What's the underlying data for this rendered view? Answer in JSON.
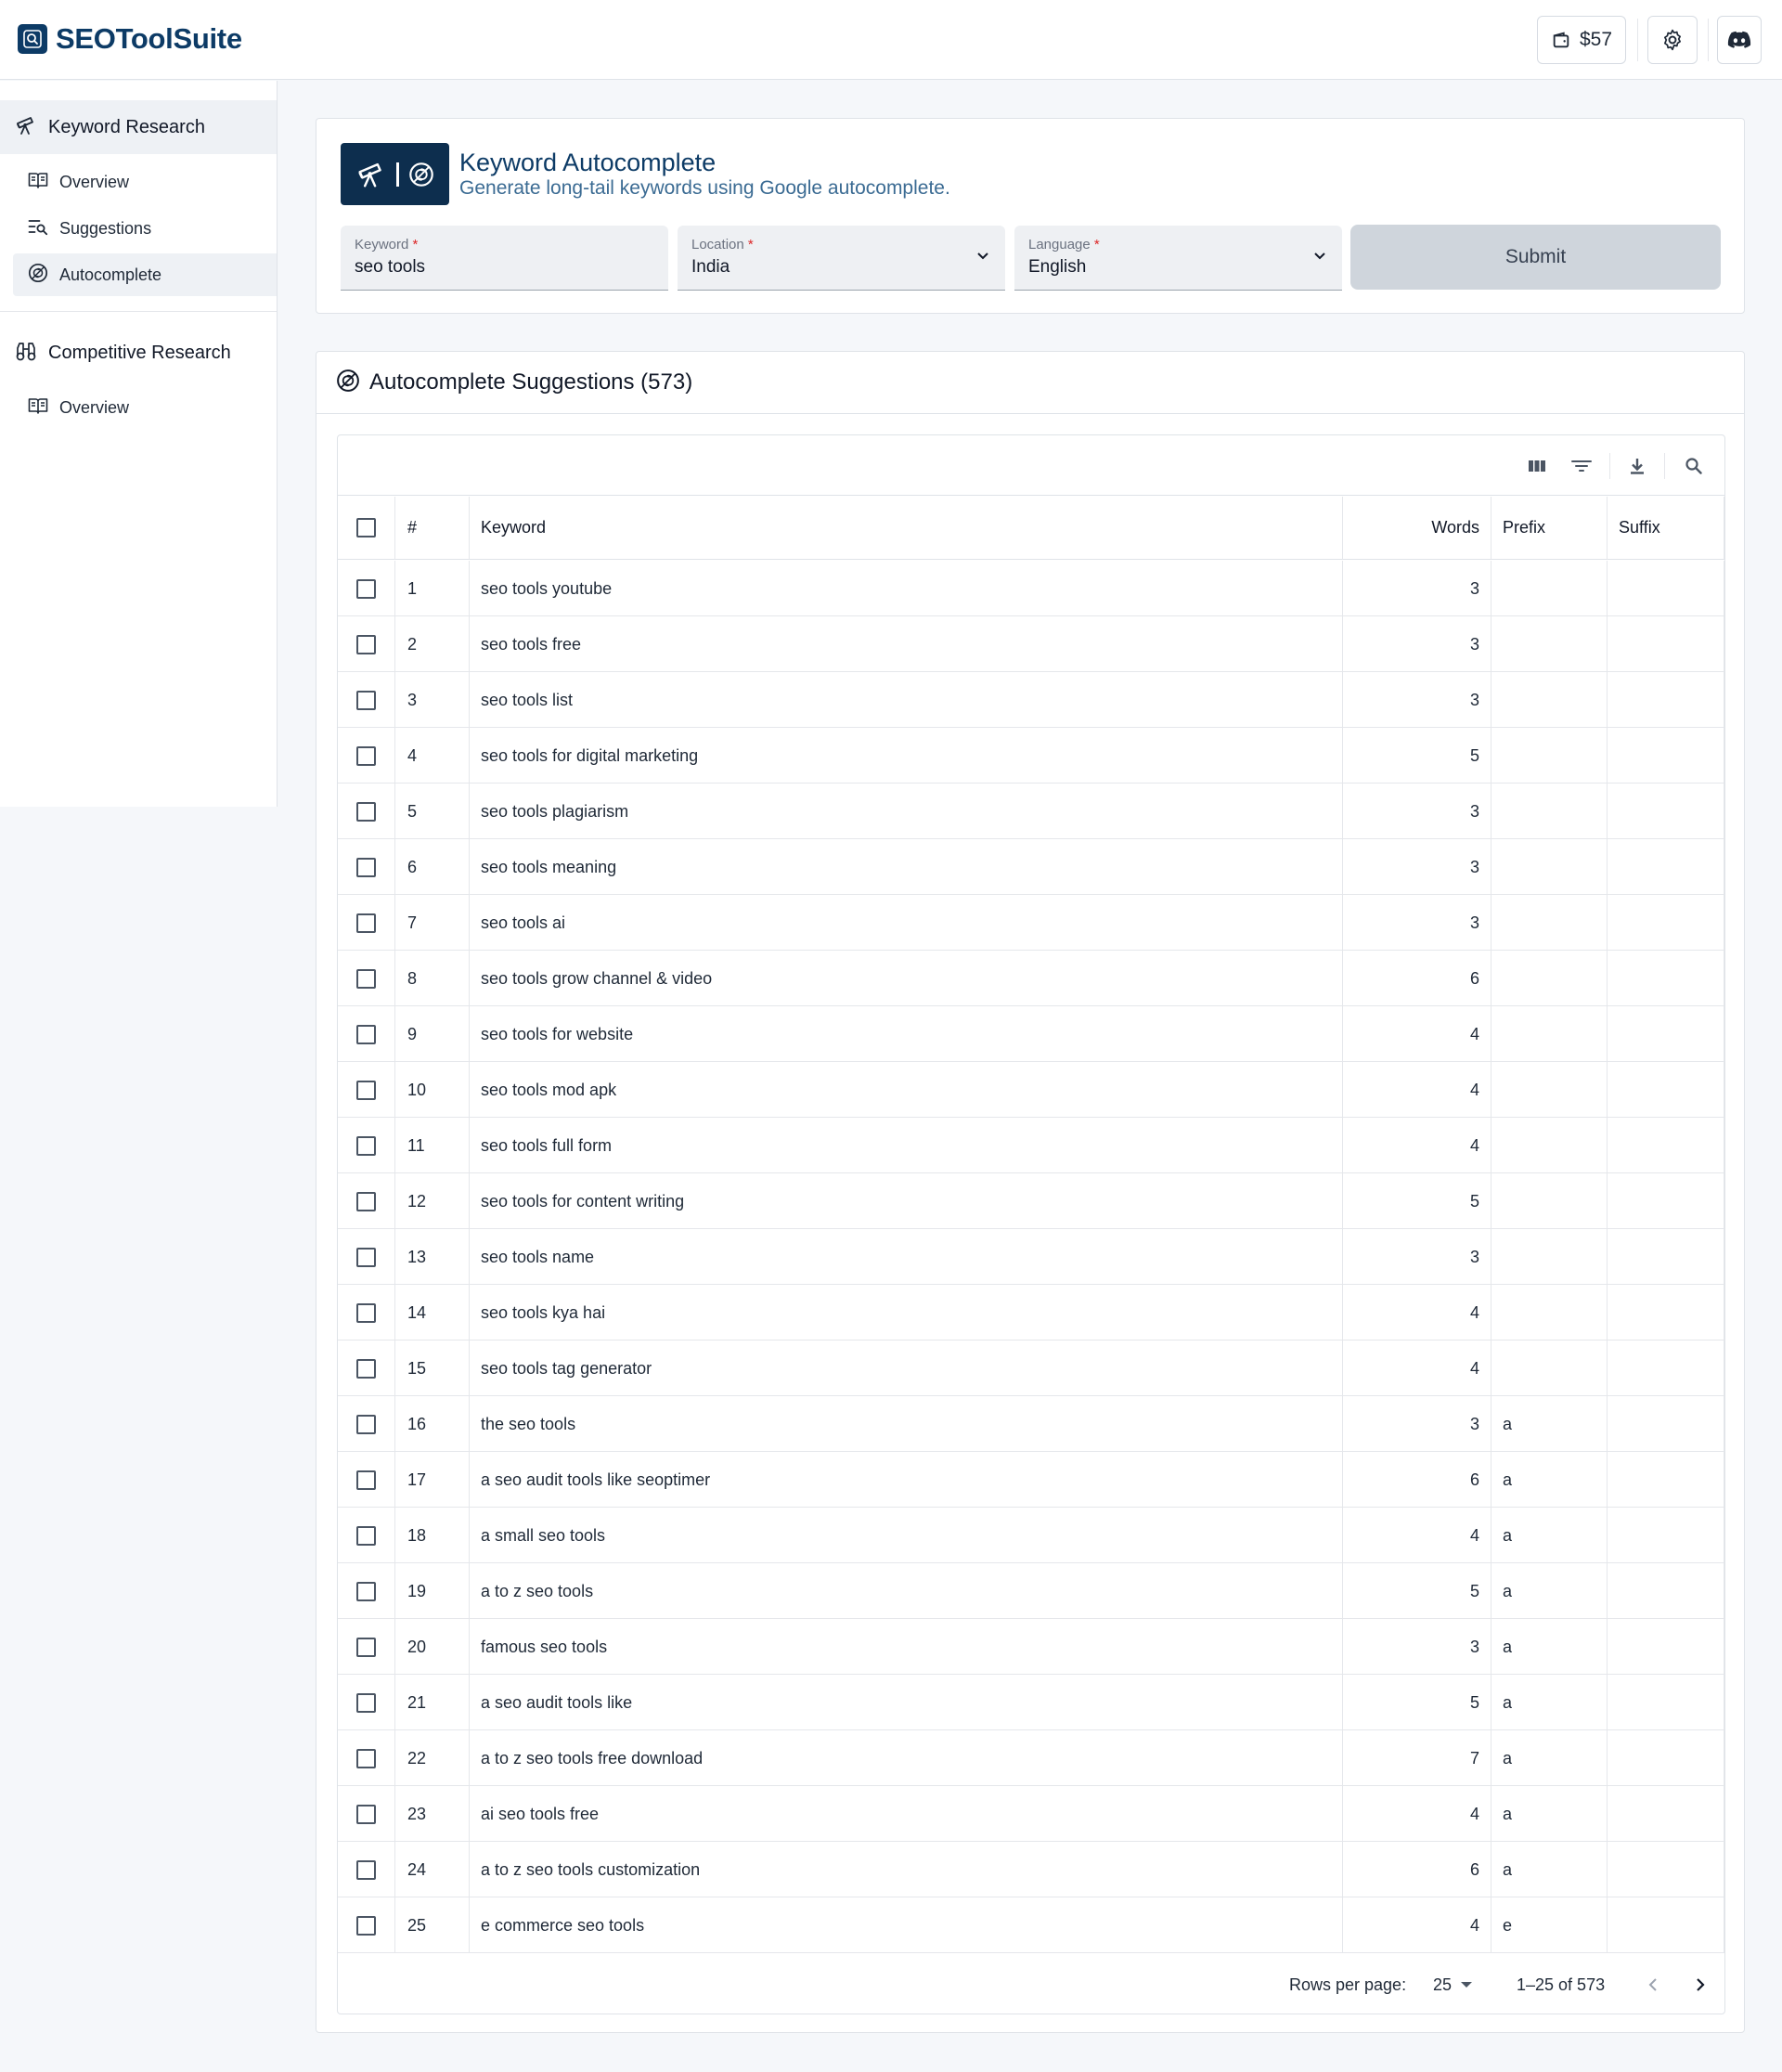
{
  "app": {
    "name": "SEOToolSuite"
  },
  "header": {
    "wallet_amount": "$57"
  },
  "sidebar": {
    "groups": [
      {
        "label": "Keyword Research",
        "items": [
          {
            "label": "Overview"
          },
          {
            "label": "Suggestions"
          },
          {
            "label": "Autocomplete"
          }
        ]
      },
      {
        "label": "Competitive Research",
        "items": [
          {
            "label": "Overview"
          }
        ]
      }
    ]
  },
  "tool": {
    "title": "Keyword Autocomplete",
    "subtitle": "Generate long-tail keywords using Google autocomplete.",
    "fields": {
      "keyword": {
        "label": "Keyword",
        "value": "seo tools"
      },
      "location": {
        "label": "Location",
        "value": "India"
      },
      "language": {
        "label": "Language",
        "value": "English"
      }
    },
    "submit_label": "Submit"
  },
  "results": {
    "title": "Autocomplete Suggestions (573)",
    "columns": {
      "index": "#",
      "keyword": "Keyword",
      "words": "Words",
      "prefix": "Prefix",
      "suffix": "Suffix"
    },
    "rows": [
      {
        "n": "1",
        "keyword": "seo tools youtube",
        "words": "3",
        "prefix": "",
        "suffix": ""
      },
      {
        "n": "2",
        "keyword": "seo tools free",
        "words": "3",
        "prefix": "",
        "suffix": ""
      },
      {
        "n": "3",
        "keyword": "seo tools list",
        "words": "3",
        "prefix": "",
        "suffix": ""
      },
      {
        "n": "4",
        "keyword": "seo tools for digital marketing",
        "words": "5",
        "prefix": "",
        "suffix": ""
      },
      {
        "n": "5",
        "keyword": "seo tools plagiarism",
        "words": "3",
        "prefix": "",
        "suffix": ""
      },
      {
        "n": "6",
        "keyword": "seo tools meaning",
        "words": "3",
        "prefix": "",
        "suffix": ""
      },
      {
        "n": "7",
        "keyword": "seo tools ai",
        "words": "3",
        "prefix": "",
        "suffix": ""
      },
      {
        "n": "8",
        "keyword": "seo tools grow channel & video",
        "words": "6",
        "prefix": "",
        "suffix": ""
      },
      {
        "n": "9",
        "keyword": "seo tools for website",
        "words": "4",
        "prefix": "",
        "suffix": ""
      },
      {
        "n": "10",
        "keyword": "seo tools mod apk",
        "words": "4",
        "prefix": "",
        "suffix": ""
      },
      {
        "n": "11",
        "keyword": "seo tools full form",
        "words": "4",
        "prefix": "",
        "suffix": ""
      },
      {
        "n": "12",
        "keyword": "seo tools for content writing",
        "words": "5",
        "prefix": "",
        "suffix": ""
      },
      {
        "n": "13",
        "keyword": "seo tools name",
        "words": "3",
        "prefix": "",
        "suffix": ""
      },
      {
        "n": "14",
        "keyword": "seo tools kya hai",
        "words": "4",
        "prefix": "",
        "suffix": ""
      },
      {
        "n": "15",
        "keyword": "seo tools tag generator",
        "words": "4",
        "prefix": "",
        "suffix": ""
      },
      {
        "n": "16",
        "keyword": "the seo tools",
        "words": "3",
        "prefix": "a",
        "suffix": ""
      },
      {
        "n": "17",
        "keyword": "a seo audit tools like seoptimer",
        "words": "6",
        "prefix": "a",
        "suffix": ""
      },
      {
        "n": "18",
        "keyword": "a small seo tools",
        "words": "4",
        "prefix": "a",
        "suffix": ""
      },
      {
        "n": "19",
        "keyword": "a to z seo tools",
        "words": "5",
        "prefix": "a",
        "suffix": ""
      },
      {
        "n": "20",
        "keyword": "famous seo tools",
        "words": "3",
        "prefix": "a",
        "suffix": ""
      },
      {
        "n": "21",
        "keyword": "a seo audit tools like",
        "words": "5",
        "prefix": "a",
        "suffix": ""
      },
      {
        "n": "22",
        "keyword": "a to z seo tools free download",
        "words": "7",
        "prefix": "a",
        "suffix": ""
      },
      {
        "n": "23",
        "keyword": "ai seo tools free",
        "words": "4",
        "prefix": "a",
        "suffix": ""
      },
      {
        "n": "24",
        "keyword": "a to z seo tools customization",
        "words": "6",
        "prefix": "a",
        "suffix": ""
      },
      {
        "n": "25",
        "keyword": "e commerce seo tools",
        "words": "4",
        "prefix": "e",
        "suffix": ""
      }
    ],
    "pagination": {
      "rows_per_page_label": "Rows per page:",
      "rows_per_page": "25",
      "range": "1–25 of 573"
    }
  },
  "colors": {
    "brand": "#0d3b66",
    "subtitle": "#3b6b93",
    "submit_bg": "#cfd5dc",
    "active_bg": "#eef1f5",
    "required": "#dc2626"
  },
  "icons": {
    "logo": "magnifier-badge-icon",
    "wallet": "wallet-icon",
    "settings": "gear-icon",
    "discord": "discord-icon",
    "keyword_research": "telescope-icon",
    "overview": "book-icon",
    "suggestions": "list-search-icon",
    "autocomplete": "swirl-icon",
    "competitive_research": "binoculars-icon",
    "toolbar": [
      "columns-icon",
      "filter-icon",
      "download-icon",
      "search-icon"
    ]
  }
}
